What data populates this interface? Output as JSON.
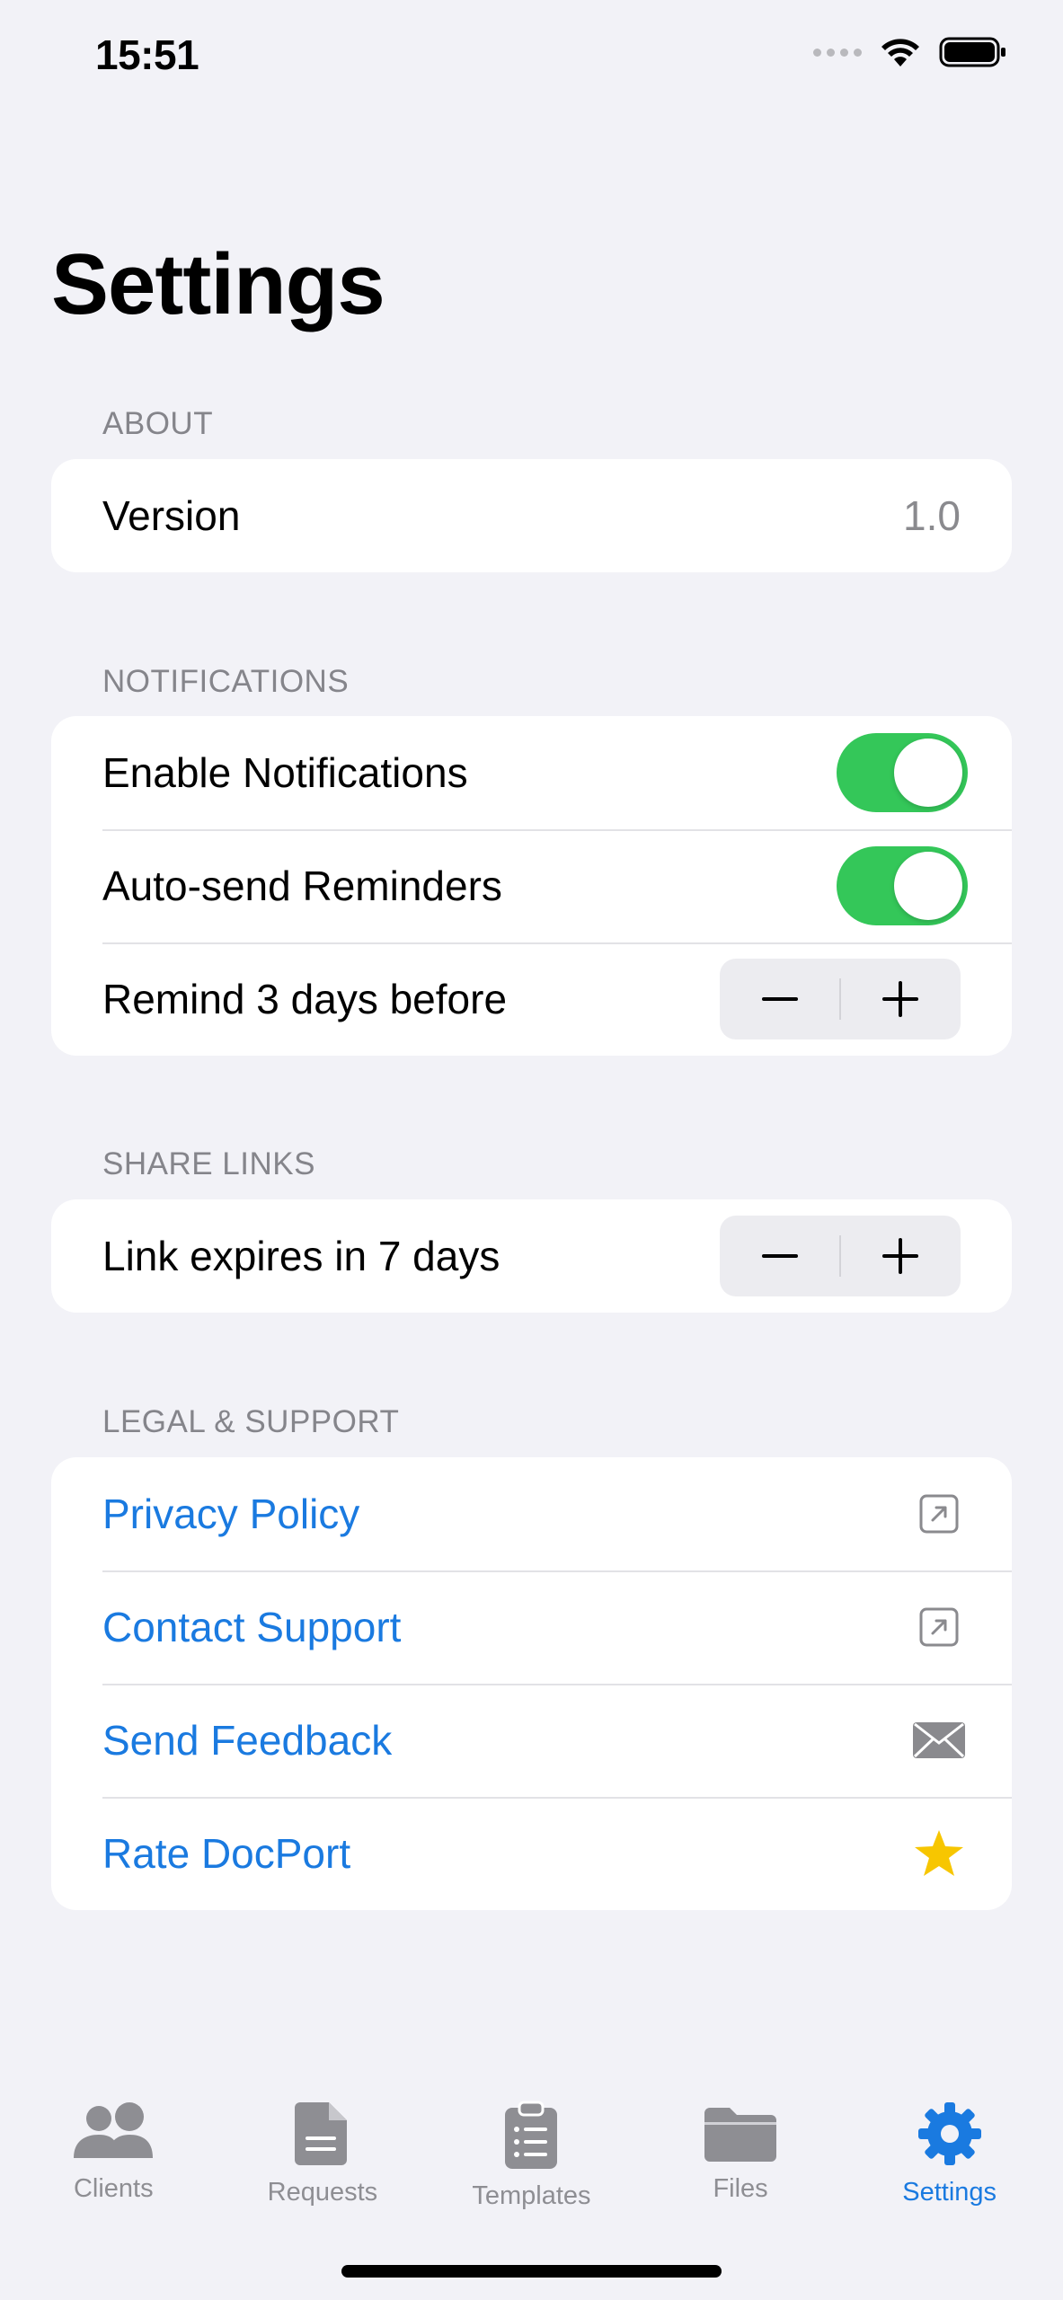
{
  "status_bar": {
    "time": "15:51"
  },
  "page": {
    "title": "Settings"
  },
  "sections": {
    "about": {
      "header": "ABOUT",
      "version_label": "Version",
      "version_value": "1.0"
    },
    "notifications": {
      "header": "NOTIFICATIONS",
      "enable_label": "Enable Notifications",
      "enable_on": true,
      "autosend_label": "Auto-send Reminders",
      "autosend_on": true,
      "remind_label": "Remind 3 days before"
    },
    "share_links": {
      "header": "SHARE LINKS",
      "expires_label": "Link expires in 7 days"
    },
    "legal": {
      "header": "LEGAL & SUPPORT",
      "items": [
        {
          "label": "Privacy Policy",
          "icon": "external-link-icon"
        },
        {
          "label": "Contact Support",
          "icon": "external-link-icon"
        },
        {
          "label": "Send Feedback",
          "icon": "envelope-icon"
        },
        {
          "label": "Rate DocPort",
          "icon": "star-icon"
        }
      ]
    }
  },
  "tabbar": {
    "items": [
      {
        "label": "Clients",
        "icon": "people-icon"
      },
      {
        "label": "Requests",
        "icon": "document-icon"
      },
      {
        "label": "Templates",
        "icon": "clipboard-icon"
      },
      {
        "label": "Files",
        "icon": "folder-icon"
      },
      {
        "label": "Settings",
        "icon": "gear-icon",
        "active": true
      }
    ]
  },
  "colors": {
    "accent": "#1a7ae0",
    "toggle_on": "#34c759",
    "star": "#f7c600",
    "background": "#f2f2f7"
  }
}
